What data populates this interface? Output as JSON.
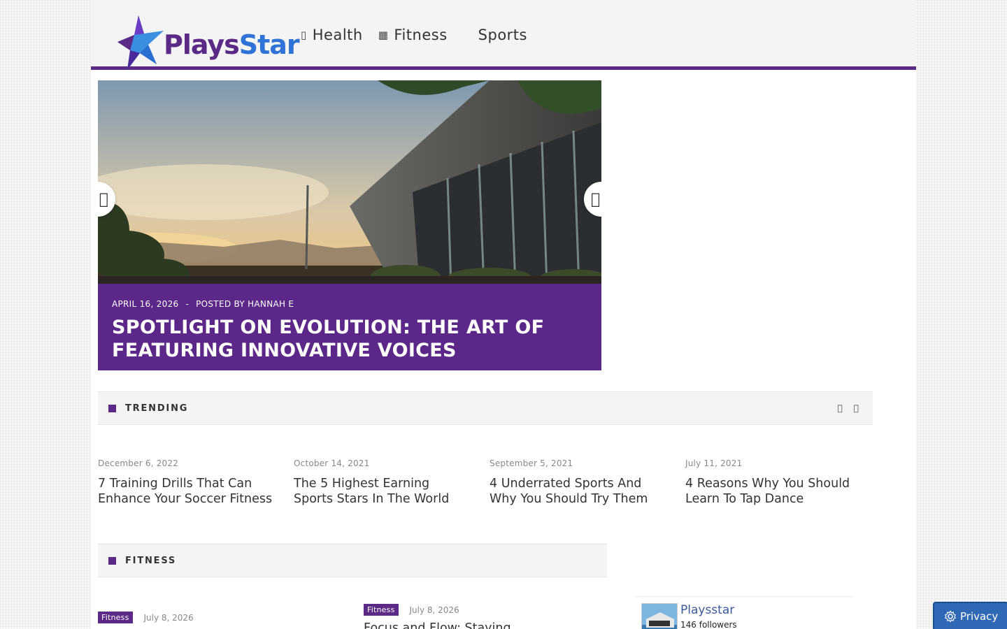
{
  "header": {
    "logo_part1": "Plays",
    "logo_part2": "Star",
    "nav": [
      {
        "label": "Health",
        "icon": "health-icon"
      },
      {
        "label": "Fitness",
        "icon": "grid-icon"
      },
      {
        "label": "Sports"
      }
    ]
  },
  "slider": {
    "date": "APRIL 16, 2026",
    "separator": "-",
    "author": "POSTED BY HANNAH E",
    "title": "SPOTLIGHT ON EVOLUTION: THE ART OF FEATURING INNOVATIVE VOICES",
    "prev_icon": "",
    "next_icon": ""
  },
  "trending": {
    "label": "TRENDING",
    "prev_icon": "",
    "next_icon": "",
    "items": [
      {
        "date": "December 6, 2022",
        "title": "7 Training Drills That Can Enhance Your Soccer Fitness"
      },
      {
        "date": "October 14, 2021",
        "title": "The 5 Highest Earning Sports Stars In The World"
      },
      {
        "date": "September 5, 2021",
        "title": "4 Underrated Sports And Why You Should Try Them"
      },
      {
        "date": "July 11, 2021",
        "title": "4 Reasons Why You Should Learn To Tap Dance"
      }
    ]
  },
  "fitness": {
    "label": "FITNESS",
    "items": [
      {
        "badge": "Fitness",
        "date": "July 8, 2026",
        "title": ""
      },
      {
        "badge": "Fitness",
        "date": "July 8, 2026",
        "title": "Focus and Flow: Staying"
      }
    ]
  },
  "social": {
    "name": "Playsstar",
    "followers": "146 followers"
  },
  "privacy": {
    "label": "Privacy"
  },
  "colors": {
    "accent": "#5b2a86",
    "blue": "#2f73d6",
    "privacy": "#2f69b6"
  }
}
